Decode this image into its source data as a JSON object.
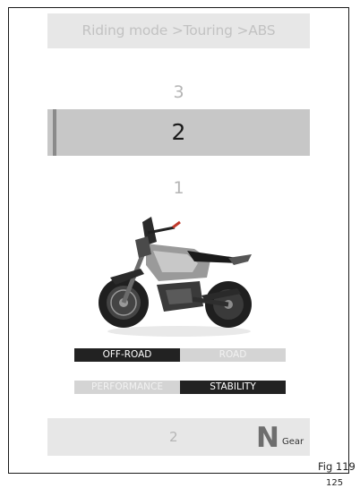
{
  "header": {
    "breadcrumb": "Riding mode >Touring >ABS"
  },
  "levels": {
    "above": "3",
    "selected": "2",
    "below": "1"
  },
  "toggles": {
    "row1": [
      {
        "label": "OFF-ROAD",
        "active": true
      },
      {
        "label": "ROAD",
        "active": false
      }
    ],
    "row2": [
      {
        "label": "PERFORMANCE",
        "active": false
      },
      {
        "label": "STABILITY",
        "active": true
      }
    ]
  },
  "footer": {
    "value": "2",
    "gear": "N",
    "gear_label": "Gear"
  },
  "figure_label": "Fig 119",
  "page_number": "125",
  "colors": {
    "header_bg": "#e7e7e7",
    "selected_bg": "#c7c7c7",
    "active_toggle": "#222222",
    "inactive_toggle": "#d4d4d4"
  }
}
